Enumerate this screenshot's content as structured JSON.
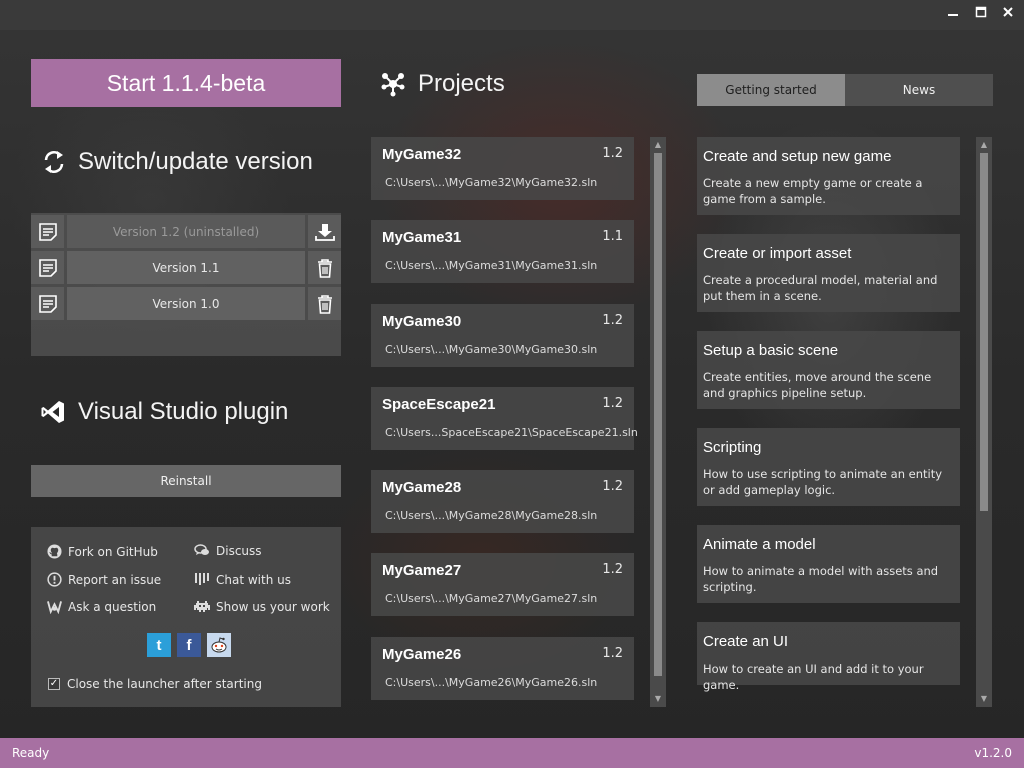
{
  "window": {
    "minimize_glyph": "▬",
    "maximize_glyph": "■",
    "close_glyph": "✕"
  },
  "start_button": {
    "label": "Start 1.1.4-beta"
  },
  "switch_section": {
    "title": "Switch/update version",
    "icon": "refresh-icon"
  },
  "versions": [
    {
      "label": "Version 1.2 (uninstalled)",
      "installed": false,
      "action_icon": "download-icon"
    },
    {
      "label": "Version 1.1",
      "installed": true,
      "action_icon": "trash-icon"
    },
    {
      "label": "Version 1.0",
      "installed": true,
      "action_icon": "trash-icon"
    }
  ],
  "vs_section": {
    "title": "Visual Studio plugin",
    "icon": "visual-studio-icon",
    "reinstall_label": "Reinstall"
  },
  "links": {
    "fork": "Fork on GitHub",
    "discuss": "Discuss",
    "report": "Report an issue",
    "chat": "Chat with us",
    "ask": "Ask a question",
    "show": "Show us your work"
  },
  "social": {
    "twitter": "t",
    "facebook": "f"
  },
  "close_launcher": {
    "label": "Close the launcher after starting",
    "checked": true
  },
  "projects_section": {
    "title": "Projects",
    "icon": "projects-icon"
  },
  "projects": [
    {
      "name": "MyGame32",
      "version": "1.2",
      "path": "C:\\Users\\...\\MyGame32\\MyGame32.sln"
    },
    {
      "name": "MyGame31",
      "version": "1.1",
      "path": "C:\\Users\\...\\MyGame31\\MyGame31.sln"
    },
    {
      "name": "MyGame30",
      "version": "1.2",
      "path": "C:\\Users\\...\\MyGame30\\MyGame30.sln"
    },
    {
      "name": "SpaceEscape21",
      "version": "1.2",
      "path": "C:\\Users...SpaceEscape21\\SpaceEscape21.sln"
    },
    {
      "name": "MyGame28",
      "version": "1.2",
      "path": "C:\\Users\\...\\MyGame28\\MyGame28.sln"
    },
    {
      "name": "MyGame27",
      "version": "1.2",
      "path": "C:\\Users\\...\\MyGame27\\MyGame27.sln"
    },
    {
      "name": "MyGame26",
      "version": "1.2",
      "path": "C:\\Users\\...\\MyGame26\\MyGame26.sln"
    }
  ],
  "tabs": [
    {
      "label": "Getting started",
      "active": true
    },
    {
      "label": "News",
      "active": false
    }
  ],
  "guides": [
    {
      "title": "Create and setup new game",
      "desc": "Create a new empty game or create a game from a sample."
    },
    {
      "title": "Create or import asset",
      "desc": "Create a procedural model, material and put them in a scene."
    },
    {
      "title": "Setup a basic scene",
      "desc": "Create entities, move around the scene and graphics pipeline setup."
    },
    {
      "title": "Scripting",
      "desc": "How to use scripting to animate an entity or add gameplay logic."
    },
    {
      "title": "Animate a model",
      "desc": "How to animate a model with assets and scripting."
    },
    {
      "title": "Create an UI",
      "desc": "How to create an UI and add it to your game."
    }
  ],
  "status": {
    "left": "Ready",
    "right": "v1.2.0"
  },
  "colors": {
    "accent": "#a770a2",
    "panel": "#484848"
  }
}
